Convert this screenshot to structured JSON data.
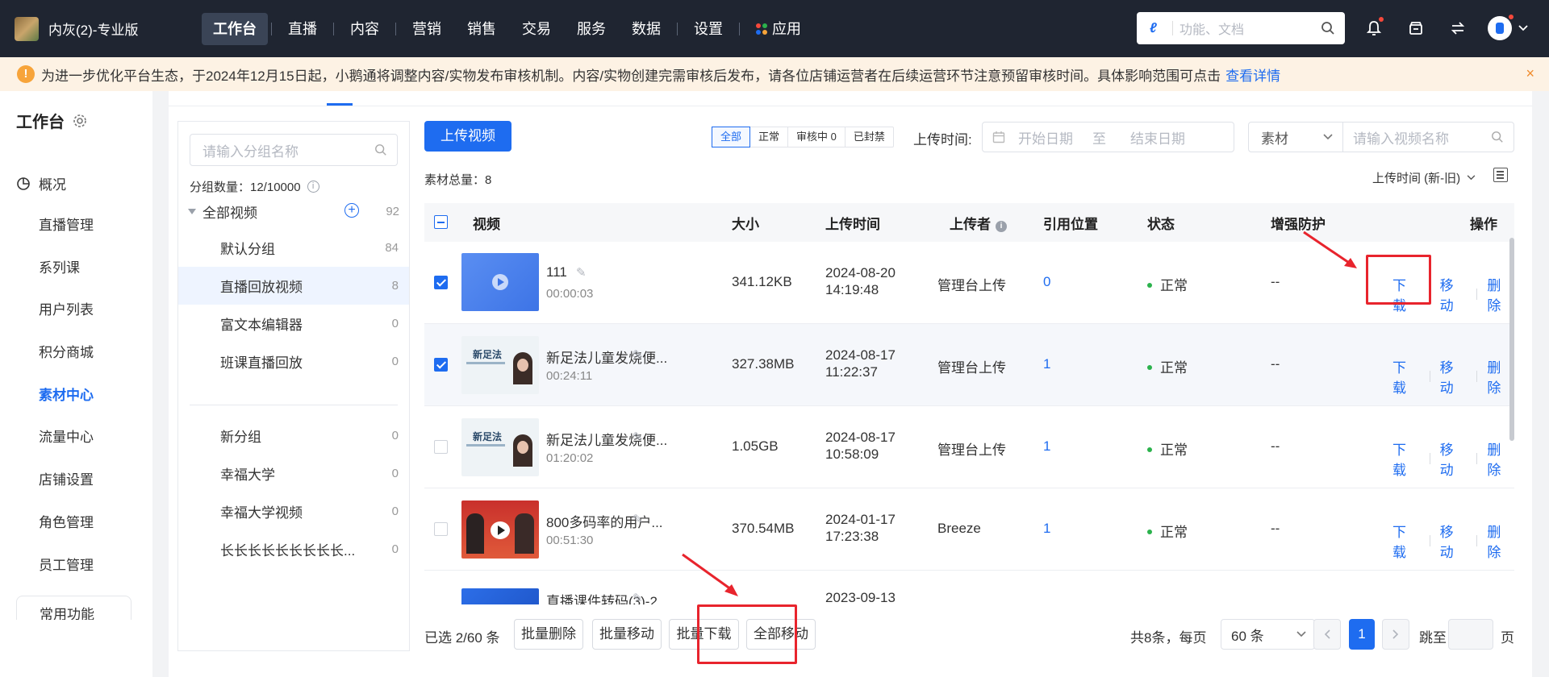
{
  "header": {
    "brand": "内灰(2)-专业版",
    "nav": [
      "工作台",
      "直播",
      "内容",
      "营销",
      "销售",
      "交易",
      "服务",
      "数据",
      "设置",
      "应用"
    ],
    "search_placeholder": "功能、文档"
  },
  "notice": {
    "text": "为进一步优化平台生态，于2024年12月15日起，小鹅通将调整内容/实物发布审核机制。内容/实物创建完需审核后发布，请各位店铺运营者在后续运营环节注意预留审核时间。具体影响范围可点击",
    "link": "查看详情",
    "close": "×"
  },
  "sidebar": {
    "title": "工作台",
    "overview": "概况",
    "items": [
      "直播管理",
      "系列课",
      "用户列表",
      "积分商城",
      "素材中心",
      "流量中心",
      "店铺设置",
      "角色管理",
      "员工管理"
    ],
    "active": "素材中心",
    "more": "常用功能"
  },
  "groups": {
    "search_placeholder": "请输入分组名称",
    "count_label": "分组数量：12/10000",
    "all_label": "全部视频",
    "all_count": "92",
    "items": [
      {
        "name": "默认分组",
        "count": "84"
      },
      {
        "name": "直播回放视频",
        "count": "8"
      },
      {
        "name": "富文本编辑器",
        "count": "0"
      },
      {
        "name": "班课直播回放",
        "count": "0"
      },
      {
        "name": "新分组",
        "count": "0"
      },
      {
        "name": "幸福大学",
        "count": "0"
      },
      {
        "name": "幸福大学视频",
        "count": "0"
      },
      {
        "name": "长长长长长长长长长...",
        "count": "0"
      }
    ]
  },
  "toolbar": {
    "upload": "上传视频",
    "filters": [
      "全部",
      "正常",
      "审核中 0",
      "已封禁"
    ],
    "upload_time_label": "上传时间:",
    "start_date": "开始日期",
    "to": "至",
    "end_date": "结束日期",
    "material_select": "素材",
    "name_placeholder": "请输入视频名称",
    "total": "素材总量：8",
    "sort": "上传时间 (新-旧)"
  },
  "table": {
    "headers": [
      "视频",
      "大小",
      "上传时间",
      "上传者",
      "引用位置",
      "状态",
      "增强防护",
      "操作"
    ],
    "rows": [
      {
        "name": "111",
        "duration": "00:00:03",
        "size": "341.12KB",
        "date": "2024-08-20",
        "time": "14:19:48",
        "uploader": "管理台上传",
        "ref": "0",
        "status": "正常",
        "protect": "--",
        "checked": true
      },
      {
        "name": "新足法儿童发烧便...",
        "duration": "00:24:11",
        "size": "327.38MB",
        "date": "2024-08-17",
        "time": "11:22:37",
        "uploader": "管理台上传",
        "ref": "1",
        "status": "正常",
        "protect": "--",
        "checked": true
      },
      {
        "name": "新足法儿童发烧便...",
        "duration": "01:20:02",
        "size": "1.05GB",
        "date": "2024-08-17",
        "time": "10:58:09",
        "uploader": "管理台上传",
        "ref": "1",
        "status": "正常",
        "protect": "--",
        "checked": false
      },
      {
        "name": "800多码率的用户...",
        "duration": "00:51:30",
        "size": "370.54MB",
        "date": "2024-01-17",
        "time": "17:23:38",
        "uploader": "Breeze",
        "ref": "1",
        "status": "正常",
        "protect": "--",
        "checked": false
      },
      {
        "name": "直播课件转码(3)-2...",
        "duration": "",
        "size": "",
        "date": "2023-09-13",
        "time": "",
        "uploader": "",
        "ref": "",
        "status": "",
        "protect": "",
        "checked": false
      }
    ],
    "ops": [
      "下载",
      "移动",
      "删除"
    ],
    "thumb_text": "新足法"
  },
  "footer": {
    "selected": "已选 2/60 条",
    "buttons": [
      "批量删除",
      "批量移动",
      "批量下载",
      "全部移动"
    ],
    "total_info": "共8条，每页",
    "page_size": "60 条",
    "current_page": "1",
    "jump_label": "跳至",
    "page_unit": "页"
  },
  "colors": {
    "primary": "#1e6cf0",
    "topbar": "#1f2531",
    "notice_bg": "#fdf2e4",
    "annotation": "#e8242d"
  }
}
